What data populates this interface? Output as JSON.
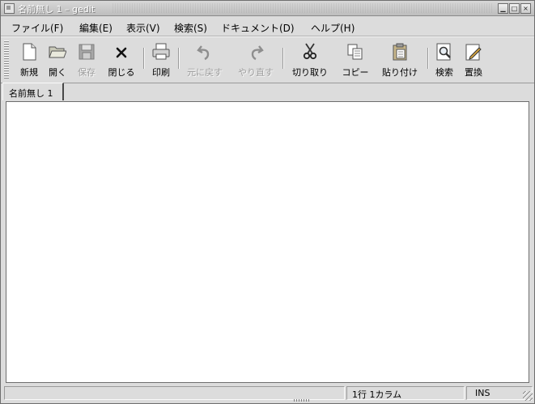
{
  "window": {
    "title": "名前無し 1 – gedit",
    "controls": [
      "minimize",
      "maximize",
      "close"
    ]
  },
  "menubar": {
    "items": [
      {
        "label": "ファイル(F)"
      },
      {
        "label": "編集(E)"
      },
      {
        "label": "表示(V)"
      },
      {
        "label": "検索(S)"
      },
      {
        "label": "ドキュメント(D)"
      },
      {
        "label": "ヘルプ(H)"
      }
    ]
  },
  "toolbar": {
    "new": {
      "label": "新規",
      "icon": "new-document-icon",
      "enabled": true
    },
    "open": {
      "label": "開く",
      "icon": "folder-icon",
      "enabled": true
    },
    "save": {
      "label": "保存",
      "icon": "floppy-disk-icon",
      "enabled": false
    },
    "close": {
      "label": "閉じる",
      "icon": "close-icon",
      "enabled": true
    },
    "print": {
      "label": "印刷",
      "icon": "printer-icon",
      "enabled": true
    },
    "undo": {
      "label": "元に戻す",
      "icon": "undo-icon",
      "enabled": false
    },
    "redo": {
      "label": "やり直す",
      "icon": "redo-icon",
      "enabled": false
    },
    "cut": {
      "label": "切り取り",
      "icon": "scissors-icon",
      "enabled": true
    },
    "copy": {
      "label": "コピー",
      "icon": "copy-icon",
      "enabled": true
    },
    "paste": {
      "label": "貼り付け",
      "icon": "clipboard-icon",
      "enabled": true
    },
    "find": {
      "label": "検索",
      "icon": "magnifier-icon",
      "enabled": true
    },
    "replace": {
      "label": "置換",
      "icon": "pencil-icon",
      "enabled": true
    }
  },
  "tabs": [
    {
      "label": "名前無し 1",
      "active": true
    }
  ],
  "editor": {
    "content": ""
  },
  "statusbar": {
    "message": "",
    "position": "1行 1カラム",
    "mode": "INS"
  }
}
